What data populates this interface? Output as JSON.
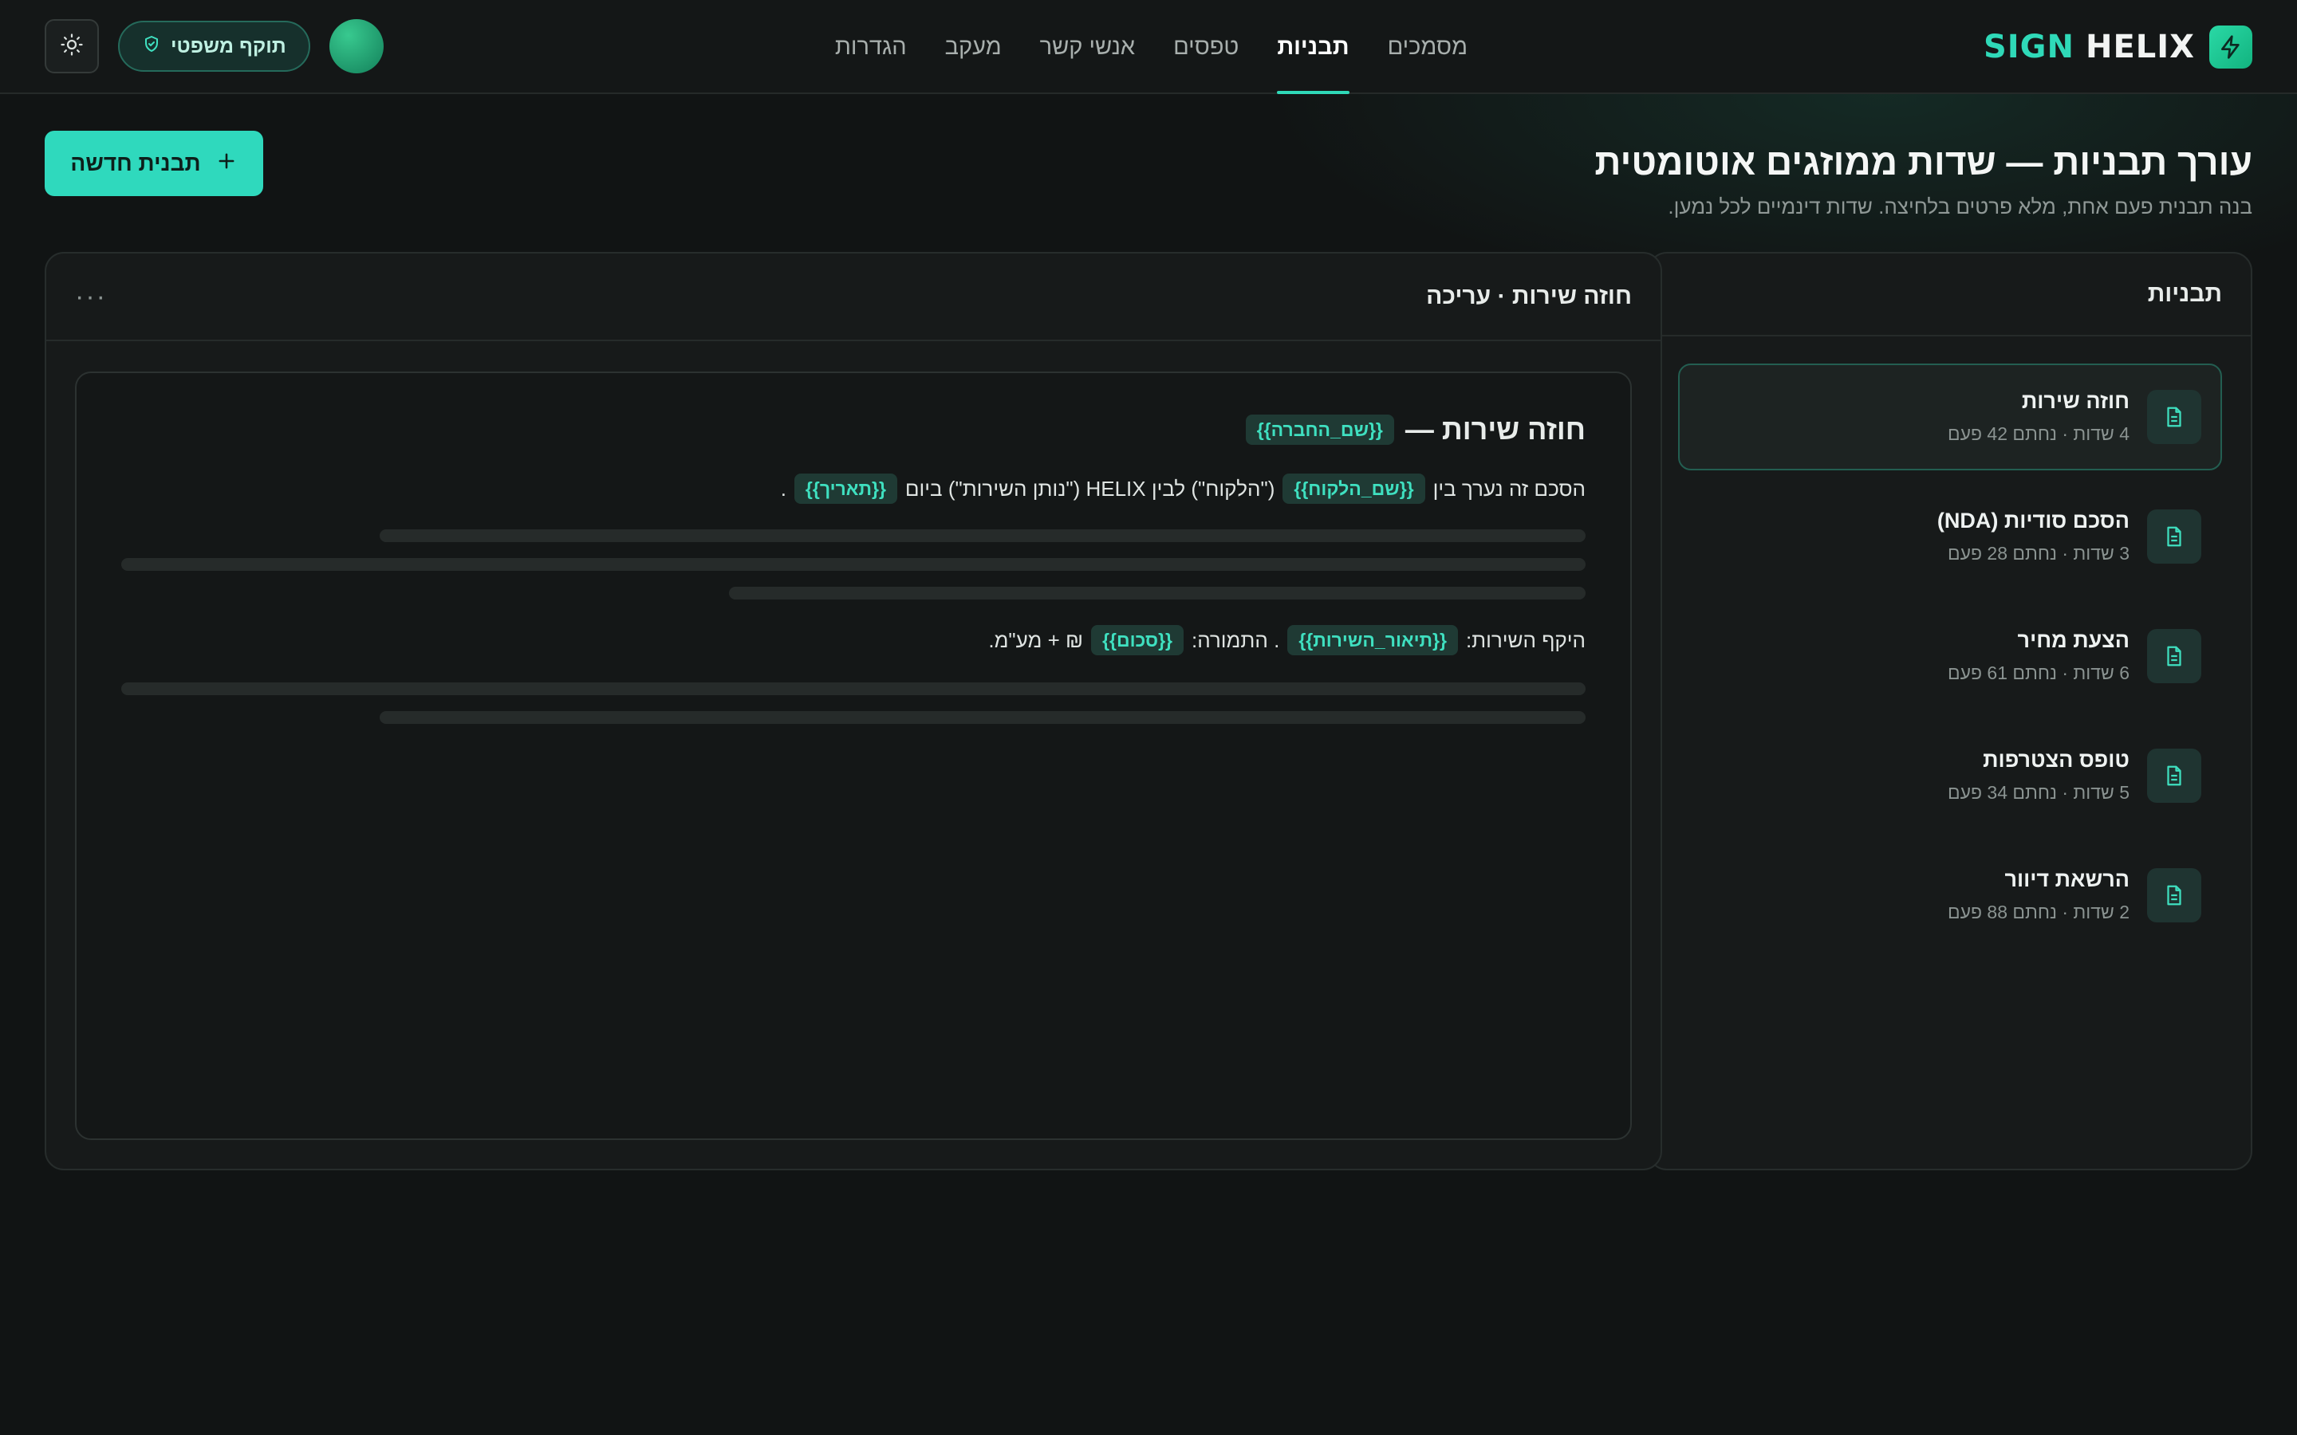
{
  "brand": {
    "sign": "SIGN",
    "helix": "HELIX"
  },
  "nav": {
    "items": [
      {
        "label": "מסמכים"
      },
      {
        "label": "תבניות",
        "active": true
      },
      {
        "label": "טפסים"
      },
      {
        "label": "אנשי קשר"
      },
      {
        "label": "מעקב"
      },
      {
        "label": "הגדרות"
      }
    ]
  },
  "header": {
    "legal_badge": "תוקף משפטי",
    "icons": {
      "theme": "sun-icon",
      "legal": "shield-check-icon"
    }
  },
  "page": {
    "title": "עורך תבניות — שדות ממוזגים אוטומטית",
    "subtitle": "בנה תבנית פעם אחת, מלא פרטים בלחיצה. שדות דינמיים לכל נמען.",
    "new_button": "תבנית חדשה"
  },
  "sidebar": {
    "title": "תבניות",
    "items": [
      {
        "name": "חוזה שירות",
        "meta": "4 שדות · נחתם 42 פעם",
        "active": true
      },
      {
        "name": "הסכם סודיות (NDA)",
        "meta": "3 שדות · נחתם 28 פעם"
      },
      {
        "name": "הצעת מחיר",
        "meta": "6 שדות · נחתם 61 פעם"
      },
      {
        "name": "טופס הצטרפות",
        "meta": "5 שדות · נחתם 34 פעם"
      },
      {
        "name": "הרשאת דיוור",
        "meta": "2 שדות · נחתם 88 פעם"
      }
    ]
  },
  "editor": {
    "title": "חוזה שירות · עריכה",
    "more": "···",
    "doc": {
      "heading": "חוזה שירות —",
      "heading_field": "{{שם_החברה}}",
      "line1": {
        "a": "הסכם זה נערך בין",
        "field1": "{{שם_הלקוח}}",
        "b": "(\"הלקוח\") לבין HELIX (\"נותן השירות\") ביום",
        "field2": "{{תאריך}}",
        "c": "."
      },
      "line2": {
        "a": "היקף השירות:",
        "field1": "{{תיאור_השירות}}",
        "b": ". התמורה:",
        "field2": "{{סכום}}",
        "c": "₪ + מע\"מ."
      }
    }
  },
  "colors": {
    "accent": "#2fd9bd",
    "background": "#111414",
    "panel": "#171a1a"
  }
}
